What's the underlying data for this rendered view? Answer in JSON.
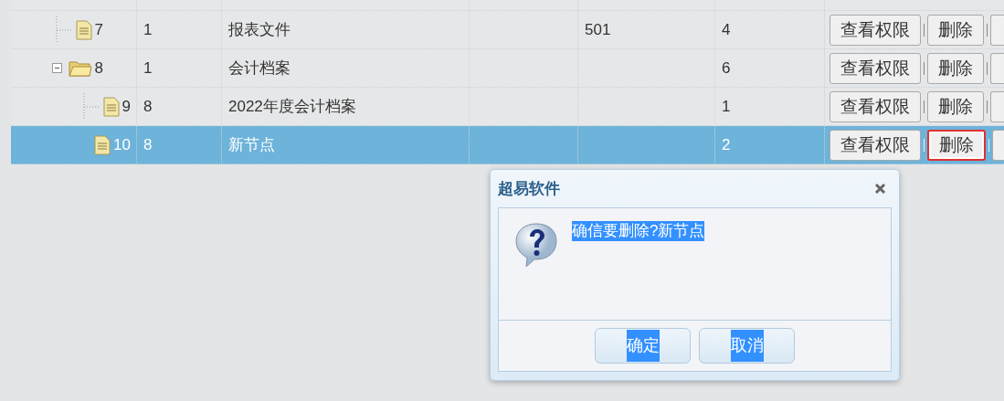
{
  "tree_grid": {
    "rows": [
      {
        "id": "7",
        "kind": "file",
        "parent": "1",
        "name": "报表文件",
        "code": "501",
        "count": "4",
        "selected": false,
        "actions": [
          {
            "label": "查看权限",
            "focused": false
          },
          {
            "label": "删除",
            "focused": false
          }
        ]
      },
      {
        "id": "8",
        "kind": "folder",
        "expanded": true,
        "parent": "1",
        "name": "会计档案",
        "count": "6",
        "selected": false,
        "actions": [
          {
            "label": "查看权限",
            "focused": false
          },
          {
            "label": "删除",
            "focused": false
          }
        ],
        "children": [
          {
            "id": "9",
            "kind": "file",
            "parent": "8",
            "name": "2022年度会计档案",
            "count": "1",
            "selected": false,
            "actions": [
              {
                "label": "查看权限",
                "focused": false
              },
              {
                "label": "删除",
                "focused": false
              }
            ]
          },
          {
            "id": "10",
            "kind": "file",
            "parent": "8",
            "name": "新节点",
            "count": "2",
            "selected": true,
            "actions": [
              {
                "label": "查看权限",
                "focused": false
              },
              {
                "label": "删除",
                "focused": true
              }
            ]
          }
        ]
      }
    ]
  },
  "dialog": {
    "title": "超易软件",
    "message": {
      "text": "确信要删除?新节点",
      "highlighted": true
    },
    "buttons": [
      {
        "label": "确定",
        "highlighted": true
      },
      {
        "label": "取消",
        "highlighted": true
      }
    ]
  }
}
